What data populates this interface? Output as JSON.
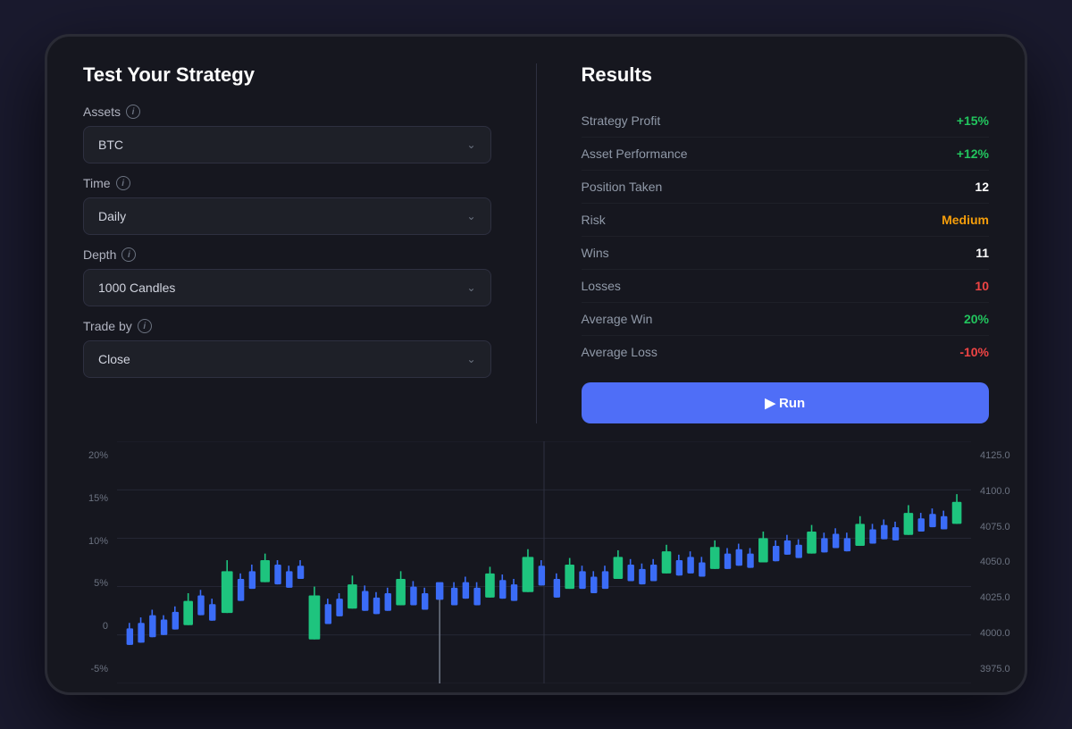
{
  "left": {
    "title": "Test Your Strategy",
    "fields": [
      {
        "label": "Assets",
        "show_info": true,
        "value": "BTC"
      },
      {
        "label": "Time",
        "show_info": true,
        "value": "Daily"
      },
      {
        "label": "Depth",
        "show_info": true,
        "value": "1000 Candles"
      },
      {
        "label": "Trade by",
        "show_info": true,
        "value": "Close"
      }
    ]
  },
  "right": {
    "title": "Results",
    "rows": [
      {
        "label": "Strategy Profit",
        "value": "+15%",
        "color": "green"
      },
      {
        "label": "Asset Performance",
        "value": "+12%",
        "color": "green"
      },
      {
        "label": "Position Taken",
        "value": "12",
        "color": "white"
      },
      {
        "label": "Risk",
        "value": "Medium",
        "color": "yellow"
      },
      {
        "label": "Wins",
        "value": "11",
        "color": "white"
      },
      {
        "label": "Losses",
        "value": "10",
        "color": "red"
      },
      {
        "label": "Average Win",
        "value": "20%",
        "color": "green"
      },
      {
        "label": "Average Loss",
        "value": "-10%",
        "color": "red"
      }
    ],
    "run_button": "▶ Run"
  },
  "chart": {
    "y_left_labels": [
      "20%",
      "15%",
      "10%",
      "5%",
      "0",
      "-5%"
    ],
    "y_right_labels": [
      "4125.0",
      "4100.0",
      "4075.0",
      "4050.0",
      "4025.0",
      "4000.0",
      "3975.0"
    ]
  }
}
